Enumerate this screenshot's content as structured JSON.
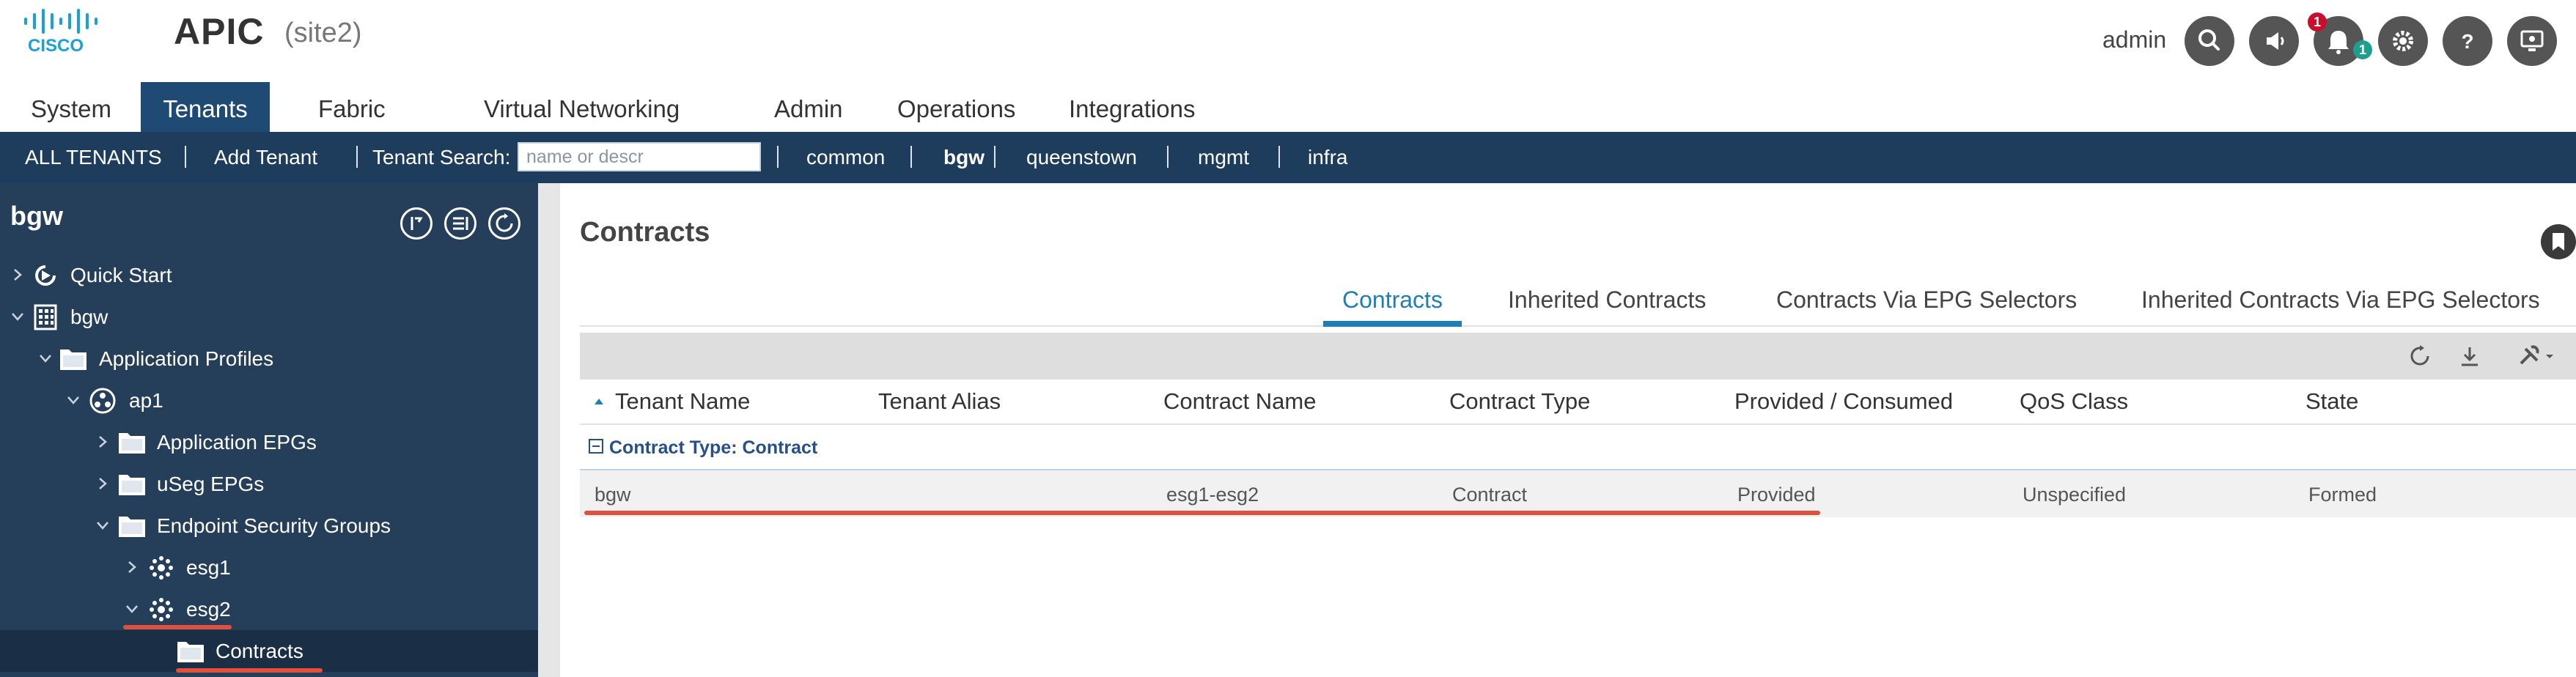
{
  "header": {
    "app_title": "APIC",
    "site_name": "(site2)",
    "user_name": "admin",
    "notification_badge_red": "1",
    "notification_badge_teal": "1",
    "icons": [
      "search-icon",
      "announcement-icon",
      "notification-bell-icon",
      "settings-gear-icon",
      "help-icon",
      "screen-icon"
    ]
  },
  "main_tabs": [
    {
      "label": "System"
    },
    {
      "label": "Tenants"
    },
    {
      "label": "Fabric"
    },
    {
      "label": "Virtual Networking"
    },
    {
      "label": "Admin"
    },
    {
      "label": "Operations"
    },
    {
      "label": "Integrations"
    }
  ],
  "tenant_bar": {
    "all_tenants": "ALL TENANTS",
    "add_tenant": "Add Tenant",
    "search_label": "Tenant Search:",
    "search_placeholder": "name or descr",
    "tenants": [
      "common",
      "bgw",
      "queenstown",
      "mgmt",
      "infra"
    ]
  },
  "left_nav": {
    "title": "bgw",
    "items": [
      {
        "label": "Quick Start"
      },
      {
        "label": "bgw"
      },
      {
        "label": "Application Profiles"
      },
      {
        "label": "ap1"
      },
      {
        "label": "Application EPGs"
      },
      {
        "label": "uSeg EPGs"
      },
      {
        "label": "Endpoint Security Groups"
      },
      {
        "label": "esg1"
      },
      {
        "label": "esg2"
      },
      {
        "label": "Contracts"
      }
    ]
  },
  "content": {
    "title": "Contracts",
    "tabs": [
      {
        "label": "Contracts"
      },
      {
        "label": "Inherited Contracts"
      },
      {
        "label": "Contracts Via EPG Selectors"
      },
      {
        "label": "Inherited Contracts Via EPG Selectors"
      }
    ],
    "columns": [
      "Tenant Name",
      "Tenant Alias",
      "Contract Name",
      "Contract Type",
      "Provided / Consumed",
      "QoS Class",
      "State"
    ],
    "group_label": "Contract Type: Contract",
    "rows": [
      {
        "tenant_name": "bgw",
        "tenant_alias": "",
        "contract_name": "esg1-esg2",
        "contract_type": "Contract",
        "provided_consumed": "Provided",
        "qos_class": "Unspecified",
        "state": "Formed"
      }
    ]
  },
  "colors": {
    "active_tab": "#1f4a73",
    "tenant_bar": "#1e3d5c",
    "left_nav": "#253e5a",
    "accent_blue": "#1f7fb4",
    "highlight_red": "#e0503c"
  }
}
